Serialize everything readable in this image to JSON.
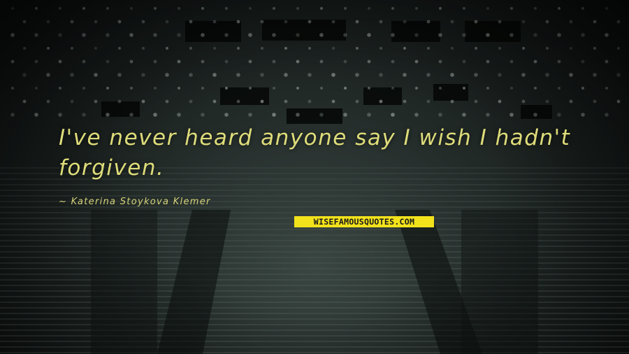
{
  "quote": {
    "text": "I've never heard anyone say I wish I hadn't forgiven.",
    "author": "~ Katerina Stoykova Klemer"
  },
  "brand": {
    "logo_text": "WISEFAMOUSQUOTES.COM"
  },
  "colors": {
    "quote_text": "#dedc7a",
    "logo_background": "#f2e21c",
    "background": "#1a201f"
  }
}
